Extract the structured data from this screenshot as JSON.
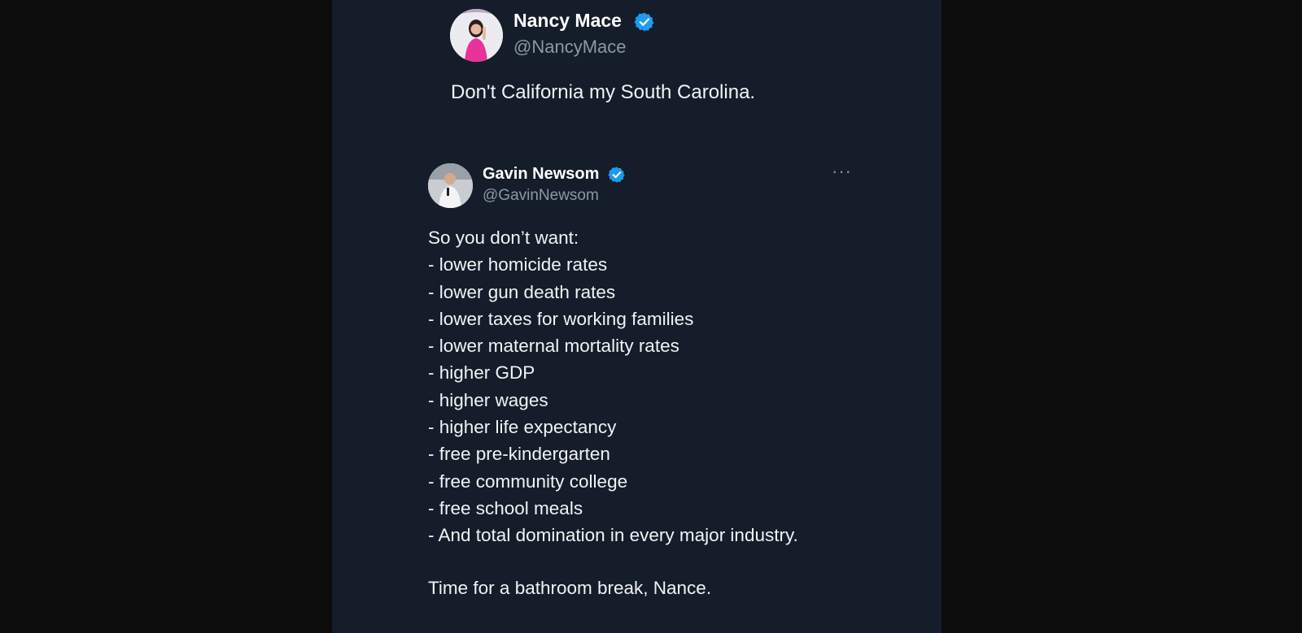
{
  "colors": {
    "background_outer": "#0c0c0d",
    "card_background": "#151d2a",
    "text_primary": "#f1f3f5",
    "text_secondary": "#8b98a5",
    "verified_blue": "#1d9bf0"
  },
  "tweet_top": {
    "display_name": "Nancy Mace",
    "handle": "@NancyMace",
    "verified_icon": "verified-badge-icon",
    "text": "Don't California my South Carolina."
  },
  "tweet_reply": {
    "display_name": "Gavin Newsom",
    "handle": "@GavinNewsom",
    "verified_icon": "verified-badge-icon",
    "more_icon": "more-options-icon",
    "more_glyph": "···",
    "lines": [
      "So you don’t want:",
      "- lower homicide rates",
      "- lower gun death rates",
      "- lower taxes for working families",
      "- lower maternal mortality rates",
      "- higher GDP",
      "- higher wages",
      "- higher life expectancy",
      "- free pre-kindergarten",
      "- free community college",
      "- free school meals",
      "- And total domination in every major industry."
    ],
    "closing": "Time for a bathroom break, Nance."
  }
}
